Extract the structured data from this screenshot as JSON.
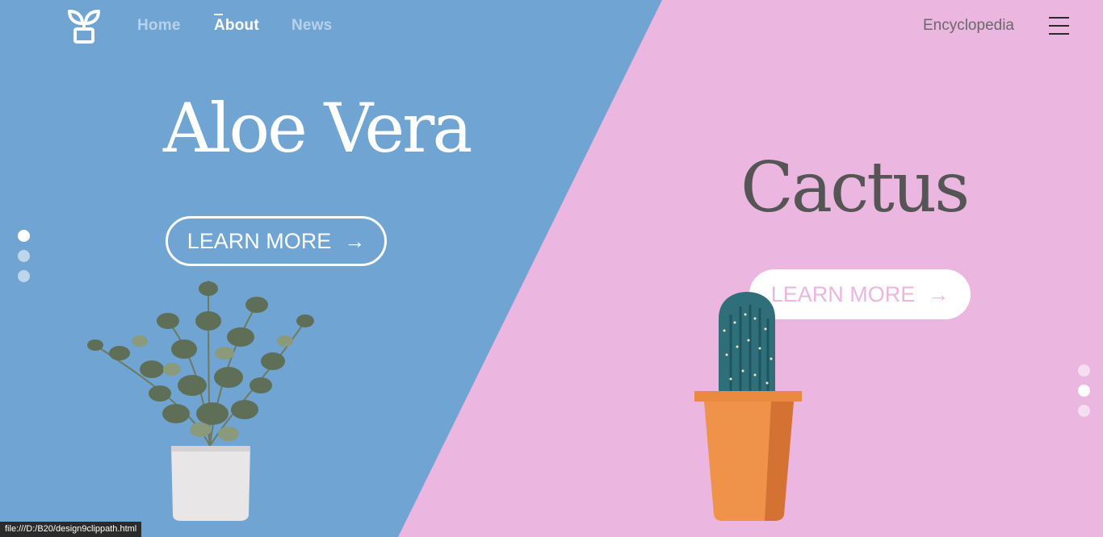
{
  "nav": {
    "home": "Home",
    "about": "About",
    "news": "News",
    "encyclopedia": "Encyclopedia"
  },
  "slides": {
    "left": {
      "title": "Aloe Vera",
      "button": "LEARN MORE"
    },
    "right": {
      "title": "Cactus",
      "button": "LEARN MORE"
    }
  },
  "pagination": {
    "left": {
      "count": 3,
      "active_index": 0
    },
    "right": {
      "count": 3,
      "active_index": 1
    }
  },
  "status_bar": {
    "url": "file:///D:/B20/design9clippath.html"
  },
  "icons": {
    "logo": "plant-pot-icon",
    "menu": "hamburger-menu-icon",
    "arrow": "arrow-right-icon"
  },
  "colors": {
    "left_bg": "#70a4d3",
    "right_bg": "#ebb6df",
    "cactus_title": "#555555"
  }
}
